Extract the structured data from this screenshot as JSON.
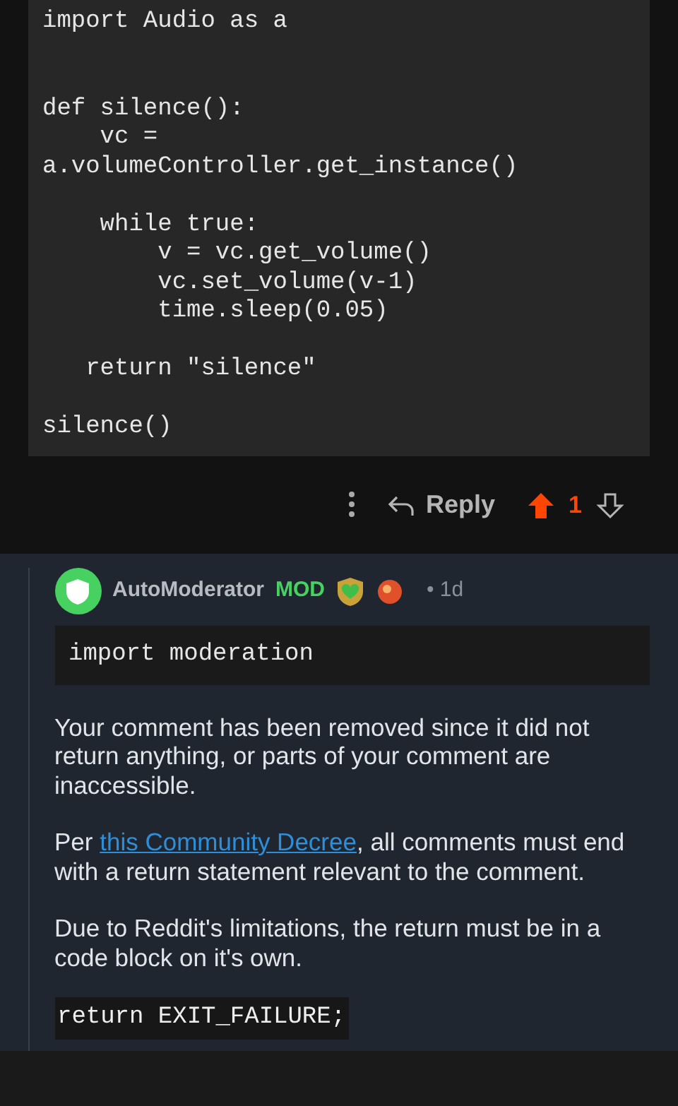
{
  "parent_comment": {
    "code": "import Audio as a\n\n\ndef silence():\n    vc =\na.volumeController.get_instance()\n\n    while true:\n        v = vc.get_volume()\n        vc.set_volume(v-1)\n        time.sleep(0.05)\n\n   return \"silence\"\n\nsilence()",
    "actions": {
      "reply_label": "Reply",
      "score": "1",
      "upvoted": true,
      "downvoted": false
    }
  },
  "reply": {
    "author": "AutoModerator",
    "flair": "MOD",
    "age": "• 1d",
    "blocks": [
      {
        "kind": "code",
        "text": "import moderation"
      },
      {
        "kind": "paragraph",
        "text": "Your comment has been removed since it did not return anything, or parts of your comment are inaccessible."
      },
      {
        "kind": "link_paragraph",
        "before": "Per ",
        "link": "this Community Decree",
        "after": ", all comments must end with a return statement relevant to the comment."
      },
      {
        "kind": "paragraph",
        "text": "Due to Reddit's limitations, the return must be in a code block on it's own."
      },
      {
        "kind": "inline_code",
        "text": "return EXIT_FAILURE;"
      }
    ]
  }
}
